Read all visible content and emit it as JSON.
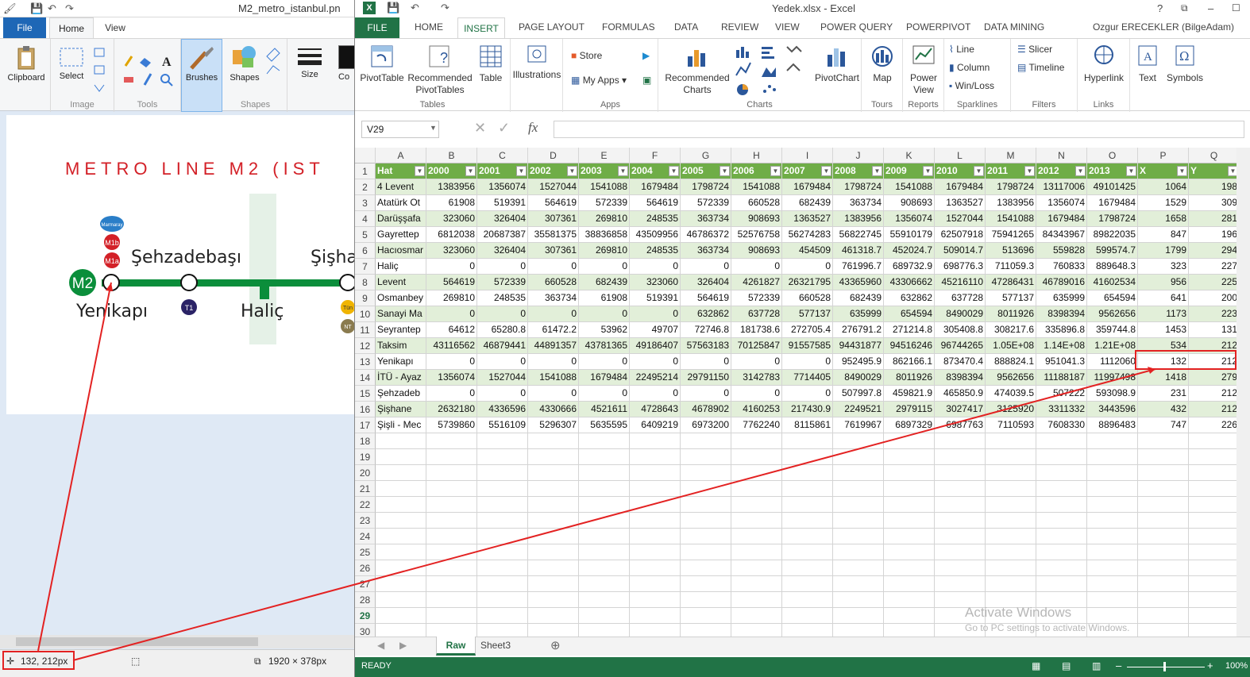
{
  "paint": {
    "title": "M2_metro_istanbul.pn",
    "tabs": {
      "file": "File",
      "home": "Home",
      "view": "View"
    },
    "groups": {
      "image": "Image",
      "tools": "Tools",
      "shapes": "Shapes"
    },
    "buttons": {
      "clipboard": "Clipboard",
      "select": "Select",
      "brushes": "Brushes",
      "shapes": "Shapes",
      "size": "Size",
      "colors": "Co"
    },
    "map": {
      "title": "METRO LINE M2 (IST",
      "line_badge": "M2",
      "stations": [
        "Yenikapı",
        "Şehzadebaşı",
        "Haliç",
        "Şişha"
      ],
      "transfers": [
        "Marmaray",
        "M1b",
        "M1a",
        "T1",
        "Tün",
        "NT"
      ]
    },
    "status": {
      "coords": "132, 212px",
      "dimensions": "1920 × 378px"
    }
  },
  "excel": {
    "title": "Yedek.xlsx - Excel",
    "tabs": {
      "file": "FILE",
      "home": "HOME",
      "insert": "INSERT",
      "page_layout": "PAGE LAYOUT",
      "formulas": "FORMULAS",
      "data": "DATA",
      "review": "REVIEW",
      "view": "VIEW",
      "power_query": "POWER QUERY",
      "powerpivot": "POWERPIVOT",
      "data_mining": "DATA MINING"
    },
    "user": "Ozgur ERECEKLER (BilgeAdam)",
    "ribbon": {
      "pivot_table": "PivotTable",
      "recommended_pivot_1": "Recommended",
      "recommended_pivot_2": "PivotTables",
      "table": "Table",
      "tables_group": "Tables",
      "illustrations": "Illustrations",
      "store": "Store",
      "my_apps": "My Apps",
      "apps_group": "Apps",
      "recommended_charts_1": "Recommended",
      "recommended_charts_2": "Charts",
      "charts_group": "Charts",
      "pivot_chart": "PivotChart",
      "map": "Map",
      "tours_group": "Tours",
      "power_view_1": "Power",
      "power_view_2": "View",
      "reports_group": "Reports",
      "line": "Line",
      "column": "Column",
      "win_loss": "Win/Loss",
      "sparklines_group": "Sparklines",
      "slicer": "Slicer",
      "timeline": "Timeline",
      "filters_group": "Filters",
      "hyperlink": "Hyperlink",
      "links_group": "Links",
      "text": "Text",
      "symbols": "Symbols"
    },
    "name_box": "V29",
    "fx": "fx",
    "columns": [
      "A",
      "B",
      "C",
      "D",
      "E",
      "F",
      "G",
      "H",
      "I",
      "J",
      "K",
      "L",
      "M",
      "N",
      "O",
      "P",
      "Q"
    ],
    "headers": [
      "Hat",
      "2000",
      "2001",
      "2002",
      "2003",
      "2004",
      "2005",
      "2006",
      "2007",
      "2008",
      "2009",
      "2010",
      "2011",
      "2012",
      "2013",
      "X",
      "Y"
    ],
    "rows": [
      [
        "4 Levent",
        "1383956",
        "1356074",
        "1527044",
        "1541088",
        "1679484",
        "1798724",
        "1541088",
        "1679484",
        "1798724",
        "1541088",
        "1679484",
        "1798724",
        "13117006",
        "49101425",
        "1064",
        "198"
      ],
      [
        "Atatürk Ot",
        "61908",
        "519391",
        "564619",
        "572339",
        "564619",
        "572339",
        "660528",
        "682439",
        "363734",
        "908693",
        "1363527",
        "1383956",
        "1356074",
        "1679484",
        "1529",
        "309"
      ],
      [
        "Darüşşafa",
        "323060",
        "326404",
        "307361",
        "269810",
        "248535",
        "363734",
        "908693",
        "1363527",
        "1383956",
        "1356074",
        "1527044",
        "1541088",
        "1679484",
        "1798724",
        "1658",
        "281"
      ],
      [
        "Gayrettep",
        "6812038",
        "20687387",
        "35581375",
        "38836858",
        "43509956",
        "46786372",
        "52576758",
        "56274283",
        "56822745",
        "55910179",
        "62507918",
        "75941265",
        "84343967",
        "89822035",
        "847",
        "196"
      ],
      [
        "Hacıosmar",
        "323060",
        "326404",
        "307361",
        "269810",
        "248535",
        "363734",
        "908693",
        "454509",
        "461318.7",
        "452024.7",
        "509014.7",
        "513696",
        "559828",
        "599574.7",
        "1799",
        "294"
      ],
      [
        "Haliç",
        "0",
        "0",
        "0",
        "0",
        "0",
        "0",
        "0",
        "0",
        "761996.7",
        "689732.9",
        "698776.3",
        "711059.3",
        "760833",
        "889648.3",
        "323",
        "227"
      ],
      [
        "Levent",
        "564619",
        "572339",
        "660528",
        "682439",
        "323060",
        "326404",
        "4261827",
        "26321795",
        "43365960",
        "43306662",
        "45216110",
        "47286431",
        "46789016",
        "41602534",
        "956",
        "225"
      ],
      [
        "Osmanbey",
        "269810",
        "248535",
        "363734",
        "61908",
        "519391",
        "564619",
        "572339",
        "660528",
        "682439",
        "632862",
        "637728",
        "577137",
        "635999",
        "654594",
        "641",
        "200"
      ],
      [
        "Sanayi Ma",
        "0",
        "0",
        "0",
        "0",
        "0",
        "632862",
        "637728",
        "577137",
        "635999",
        "654594",
        "8490029",
        "8011926",
        "8398394",
        "9562656",
        "1173",
        "223"
      ],
      [
        "Seyrantep",
        "64612",
        "65280.8",
        "61472.2",
        "53962",
        "49707",
        "72746.8",
        "181738.6",
        "272705.4",
        "276791.2",
        "271214.8",
        "305408.8",
        "308217.6",
        "335896.8",
        "359744.8",
        "1453",
        "131"
      ],
      [
        "Taksim",
        "43116562",
        "46879441",
        "44891357",
        "43781365",
        "49186407",
        "57563183",
        "70125847",
        "91557585",
        "94431877",
        "94516246",
        "96744265",
        "1.05E+08",
        "1.14E+08",
        "1.21E+08",
        "534",
        "212"
      ],
      [
        "Yenikapı",
        "0",
        "0",
        "0",
        "0",
        "0",
        "0",
        "0",
        "0",
        "952495.9",
        "862166.1",
        "873470.4",
        "888824.1",
        "951041.3",
        "1112060",
        "132",
        "212"
      ],
      [
        "İTÜ - Ayaz",
        "1356074",
        "1527044",
        "1541088",
        "1679484",
        "22495214",
        "29791150",
        "3142783",
        "7714405",
        "8490029",
        "8011926",
        "8398394",
        "9562656",
        "11188187",
        "11997498",
        "1418",
        "279"
      ],
      [
        "Şehzadeb",
        "0",
        "0",
        "0",
        "0",
        "0",
        "0",
        "0",
        "0",
        "507997.8",
        "459821.9",
        "465850.9",
        "474039.5",
        "507222",
        "593098.9",
        "231",
        "212"
      ],
      [
        "Şişhane",
        "2632180",
        "4336596",
        "4330666",
        "4521611",
        "4728643",
        "4678902",
        "4160253",
        "217430.9",
        "2249521",
        "2979115",
        "3027417",
        "3125920",
        "3311332",
        "3443596",
        "432",
        "212"
      ],
      [
        "Şişli - Mec",
        "5739860",
        "5516109",
        "5296307",
        "5635595",
        "6409219",
        "6973200",
        "7762240",
        "8115861",
        "7619967",
        "6897329",
        "6987763",
        "7110593",
        "7608330",
        "8896483",
        "747",
        "226"
      ]
    ],
    "empty_rows": [
      "18",
      "19",
      "20",
      "21",
      "22",
      "23",
      "24",
      "25",
      "26",
      "27",
      "28",
      "29",
      "30"
    ],
    "sheets": {
      "raw": "Raw",
      "sheet3": "Sheet3"
    },
    "status": "READY",
    "zoom": "100%",
    "watermark": {
      "line1": "Activate Windows",
      "line2": "Go to PC settings to activate Windows."
    }
  },
  "colors": {
    "excel_green": "#217346",
    "table_header": "#6fad47",
    "band": "#e2efd9",
    "highlight": "#e32222",
    "map_red": "#d32027",
    "line_green": "#0b8e3b"
  }
}
